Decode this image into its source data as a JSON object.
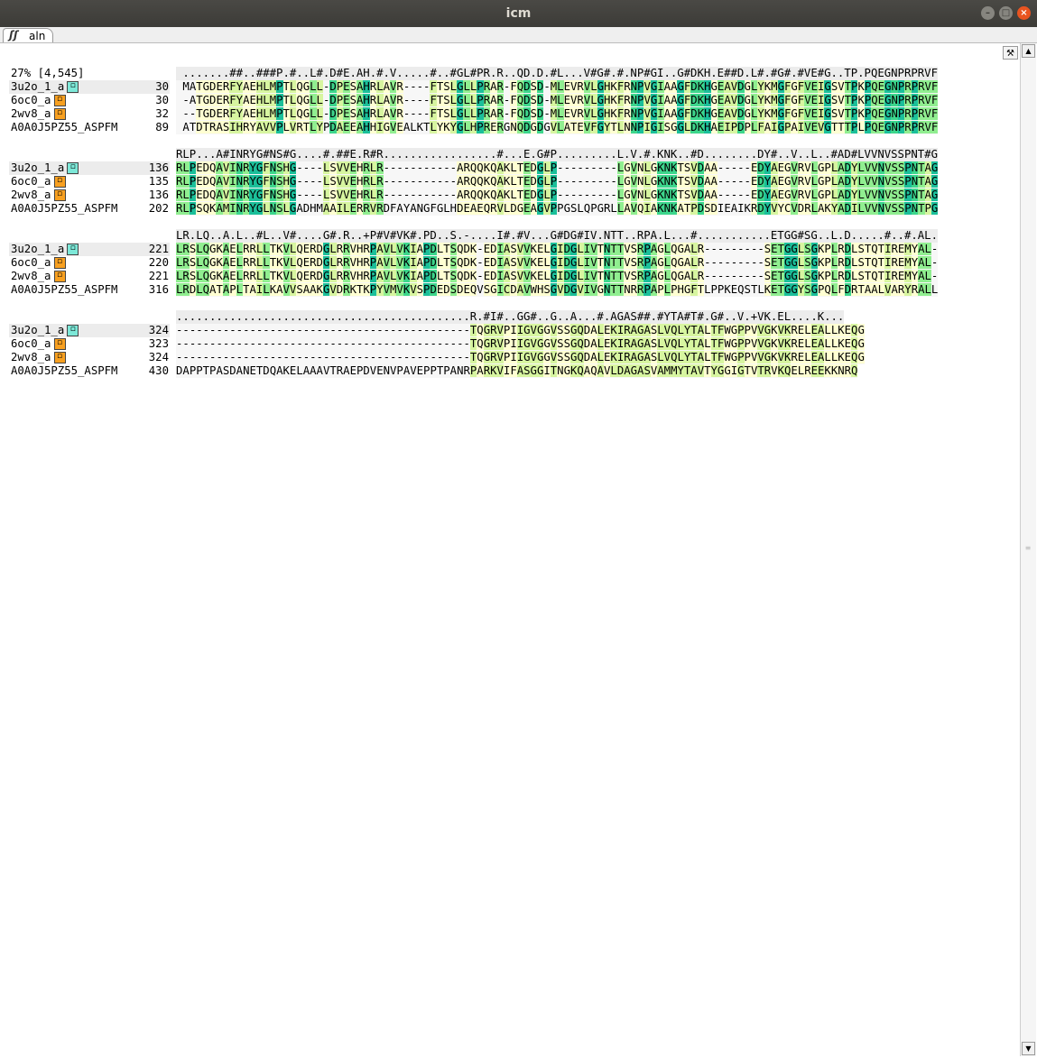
{
  "window": {
    "title": "icm",
    "tab_label": "aln",
    "tab_icon": "ss-structure-icon"
  },
  "alignment": {
    "summary": "27% [4,545]",
    "blocks": [
      {
        "consensus": " .......##..###P.#..L#.D#E.AH.#.V.....#..#GL#PR.R..QD.D.#L...V#G#.#.NP#GI..G#DKH.E##D.L#.#G#.#VE#G..TP.PQEGNPRPRVF",
        "rows": [
          {
            "name": "3u2o_1_a",
            "marker": "cyan",
            "start": "30",
            "seq": " MATGDERFYAEHLMPTLQGLL-DPESAHRLAVR----FTSLGLLPRAR-FQDSD-MLEVRVLGHKFRNPVGIAAGFDKHGEAVDGLYKMGFGFVEIGSVTPKPQEGNPRPRVF"
          },
          {
            "name": "6oc0_a",
            "marker": "orange",
            "start": "30",
            "seq": " -ATGDERFYAEHLMPTLQGLL-DPESAHRLAVR----FTSLGLLPRAR-FQDSD-MLEVRVLGHKFRNPVGIAAGFDKHGEAVDGLYKMGFGFVEIGSVTPKPQEGNPRPRVF"
          },
          {
            "name": "2wv8_a",
            "marker": "orange",
            "start": "32",
            "seq": " --TGDERFYAEHLMPTLQGLL-DPESAHRLAVR----FTSLGLLPRAR-FQDSD-MLEVRVLGHKFRNPVGIAAGFDKHGEAVDGLYKMGFGFVEIGSVTPKPQEGNPRPRVF"
          },
          {
            "name": "A0A0J5PZ55_ASPFM",
            "marker": "",
            "start": "89",
            "seq": " ATDTRASIHRYAVVPLVRTLYPDAEEAHHIGVEALKTLYKYGLHPRERGNQDGDGVLATEVFGYTLNNPIGISGGLDKHAEIPDPLFAIGPAIVEVGTTTPLPQEGNPRPRVF"
          }
        ]
      },
      {
        "consensus": "RLP...A#INRYG#NS#G....#.##E.R#R.................#...E.G#P.........L.V.#.KNK..#D........DY#..V..L..#AD#LVVNVSSPNT#G",
        "rows": [
          {
            "name": "3u2o_1_a",
            "marker": "cyan",
            "start": "136",
            "seq": "RLPEDQAVINRYGFNSHG----LSVVEHRLR-----------ARQQKQAKLTEDGLP---------LGVNLGKNKTSVDAA-----EDYAEGVRVLGPLADYLVVNVSSPNTAG"
          },
          {
            "name": "6oc0_a",
            "marker": "orange",
            "start": "135",
            "seq": "RLPEDQAVINRYGFNSHG----LSVVEHRLR-----------ARQQKQAKLTEDGLP---------LGVNLGKNKTSVDAA-----EDYAEGVRVLGPLADYLVVNVSSPNTAG"
          },
          {
            "name": "2wv8_a",
            "marker": "orange",
            "start": "136",
            "seq": "RLPEDQAVINRYGFNSHG----LSVVEHRLR-----------ARQQKQAKLTEDGLP---------LGVNLGKNKTSVDAA-----EDYAEGVRVLGPLADYLVVNVSSPNTAG"
          },
          {
            "name": "A0A0J5PZ55_ASPFM",
            "marker": "",
            "start": "202",
            "seq": "RLPSQKAMINRYGLNSLGADHMAAILERRVRDFAYANGFGLHDEAEQRVLDGEAGVPPGSLQPGRLLAVQIAKNKATPDSDIEAIKRDYVYCVDRLAKYADILVVNVSSPNTPG"
          }
        ]
      },
      {
        "consensus": "LR.LQ..A.L..#L..V#....G#.R..+P#V#VK#.PD..S.-....I#.#V...G#DG#IV.NTT..RPA.L...#...........ETGG#SG..L.D.....#..#.AL.",
        "rows": [
          {
            "name": "3u2o_1_a",
            "marker": "cyan",
            "start": "221",
            "seq": "LRSLQGKAELRRLLTKVLQERDGLRRVHRPAVLVKIAPDLTSQDK-EDIASVVKELGIDGLIVTNTTVSRPAGLQGALR---------SETGGLSGKPLRDLSTQTIREMYAL-"
          },
          {
            "name": "6oc0_a",
            "marker": "orange",
            "start": "220",
            "seq": "LRSLQGKAELRRLLTKVLQERDGLRRVHRPAVLVKIAPDLTSQDK-EDIASVVKELGIDGLIVTNTTVSRPAGLQGALR---------SETGGLSGKPLRDLSTQTIREMYAL-"
          },
          {
            "name": "2wv8_a",
            "marker": "orange",
            "start": "221",
            "seq": "LRSLQGKAELRRLLTKVLQERDGLRRVHRPAVLVKIAPDLTSQDK-EDIASVVKELGIDGLIVTNTTVSRPAGLQGALR---------SETGGLSGKPLRDLSTQTIREMYAL-"
          },
          {
            "name": "A0A0J5PZ55_ASPFM",
            "marker": "",
            "start": "316",
            "seq": "LRDLQATAPLTAILKAVVSAAKGVDRKTKPYVMVKVSPDEDSDEQVSGICDAVWHSGVDGVIVGNTTNRRPAPLPHGFTLPPKEQSTLKETGGYSGPQLFDRTAALVARYRALL"
          }
        ]
      },
      {
        "consensus": "............................................R.#I#..GG#..G..A...#.AGAS##.#YTA#T#.G#..V.+VK.EL....K...",
        "rows": [
          {
            "name": "3u2o_1_a",
            "marker": "cyan",
            "start": "324",
            "seq": "--------------------------------------------TQGRVPIIGVGGVSSGQDALEKIRAGASLVQLYTALTFWGPPVVGKVKRELEALLKEQG"
          },
          {
            "name": "6oc0_a",
            "marker": "orange",
            "start": "323",
            "seq": "--------------------------------------------TQGRVPIIGVGGVSSGQDALEKIRAGASLVQLYTALTFWGPPVVGKVKRELEALLKEQG"
          },
          {
            "name": "2wv8_a",
            "marker": "orange",
            "start": "324",
            "seq": "--------------------------------------------TQGRVPIIGVGGVSSGQDALEKIRAGASLVQLYTALTFWGPPVVGKVKRELEALLKEQG"
          },
          {
            "name": "A0A0J5PZ55_ASPFM",
            "marker": "",
            "start": "430",
            "seq": "DAPPTPASDANETDQAKELAAAVTRAEPDVENVPAVEPPTPANRPARKVIFASGGITNGKQAQAVLDAGASVAMMYTAVTYGGIGTVTRVKQELREEKKNRQ"
          }
        ]
      }
    ]
  },
  "colors": {
    "titlebar": "#3c3b37",
    "close_button": "#e95420",
    "marker_cyan": "#7de8d8",
    "marker_orange": "#f8a020",
    "conservation_levels": [
      "#ffffd2",
      "#d7f5a0",
      "#90ee90",
      "#3dd68c",
      "#1bbf9a"
    ]
  }
}
